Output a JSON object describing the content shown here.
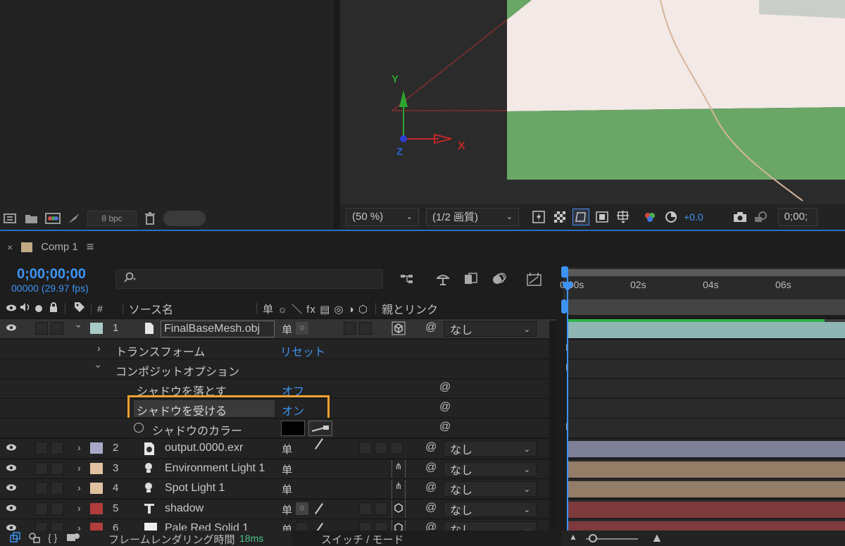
{
  "project_toolbar": {
    "bpc_label": "8 bpc",
    "icons": [
      "interpret-footage-icon",
      "folder-icon",
      "composition-icon",
      "render-queue-icon",
      "bpc-toggle",
      "trash-icon"
    ]
  },
  "viewer": {
    "axis_labels": {
      "y": "Y",
      "x": "X",
      "z": "Z"
    },
    "zoom": "(50 %)",
    "resolution": "(1/2 画質)",
    "exposure": "+0.0",
    "timecode_partial": "0;00;"
  },
  "timeline": {
    "tab_label": "Comp 1",
    "tab_close": "×",
    "tab_menu": "≡",
    "tab_color": "#c2a985",
    "current_time": "0;00;00;00",
    "frame_info": "00000 (29.97 fps)",
    "search_placeholder": "",
    "ruler_ticks": [
      "0:00s",
      "02s",
      "04s",
      "06s"
    ],
    "columns": {
      "number": "#",
      "source_name": "ソース名",
      "switches": "单 ☼ ＼ fx ▤ ◎ ◑ ⬡",
      "parent": "親とリンク"
    }
  },
  "layers": [
    {
      "id": 1,
      "name": "FinalBaseMesh.obj",
      "color": "#a8cbc7",
      "parent": "なし",
      "type": "3d-mesh",
      "expanded": true,
      "selected": true,
      "bar_color": "#8fb6b3"
    },
    {
      "id": 2,
      "name": "output.0000.exr",
      "color": "#a8a9c9",
      "parent": "なし",
      "type": "footage",
      "bar_color": "#7c7f96"
    },
    {
      "id": 3,
      "name": "Environment Light 1",
      "color": "#e1c2a0",
      "parent": "なし",
      "type": "light",
      "bar_color": "#937d67"
    },
    {
      "id": 4,
      "name": "Spot Light 1",
      "color": "#e1c2a0",
      "parent": "なし",
      "type": "light",
      "bar_color": "#937d67"
    },
    {
      "id": 5,
      "name": "shadow",
      "color": "#b33c3c",
      "parent": "なし",
      "type": "text",
      "bar_color": "#7e3a3d"
    },
    {
      "id": 6,
      "name": "Pale Red Solid 1",
      "color": "#b33c3c",
      "parent": "なし",
      "type": "solid",
      "bar_color": "#7e3a3d"
    }
  ],
  "properties": {
    "transform": {
      "label": "トランスフォーム",
      "reset": "リセット"
    },
    "composite_options": {
      "label": "コンポジットオプション"
    },
    "casts_shadows": {
      "label": "シャドウを落とす",
      "value": "オフ"
    },
    "accepts_shadows": {
      "label": "シャドウを受ける",
      "value": "オン"
    },
    "shadow_color": {
      "label": "シャドウのカラー",
      "value_color": "#000000"
    }
  },
  "highlight_color": "#f0a030",
  "status": {
    "render_time_label": "フレームレンダリング時間",
    "render_time_value": "18ms",
    "switch_mode": "スイッチ / モード"
  }
}
